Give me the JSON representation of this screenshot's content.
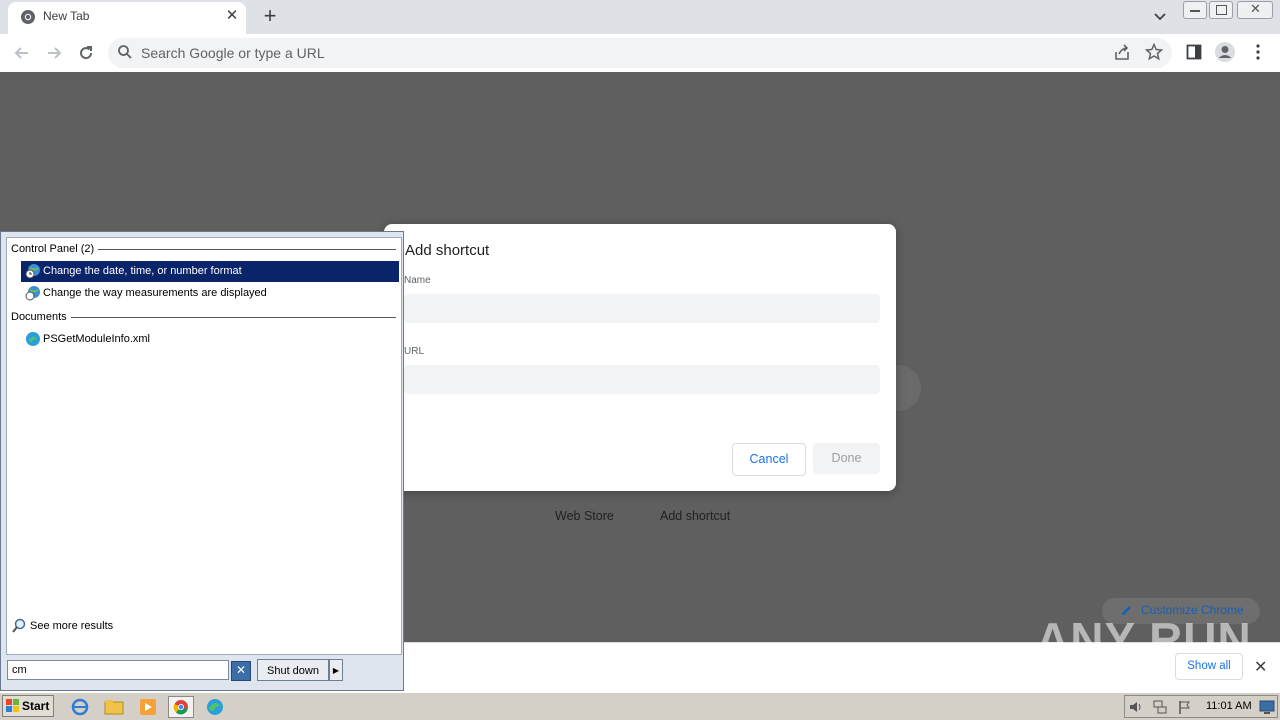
{
  "browser": {
    "tab_title": "New Tab",
    "omnibox_placeholder": "Search Google or type a URL"
  },
  "page": {
    "shortcuts": [
      "Web Store",
      "Add shortcut"
    ],
    "customize_label": "Customize Chrome"
  },
  "dialog": {
    "title": "Add shortcut",
    "name_label": "Name",
    "name_value": "",
    "url_label": "URL",
    "url_value": "",
    "cancel_label": "Cancel",
    "done_label": "Done"
  },
  "download_bar": {
    "show_all_label": "Show all"
  },
  "watermark": "ANY RUN",
  "start_menu": {
    "groups": [
      {
        "title": "Control Panel (2)"
      },
      {
        "title": "Documents"
      }
    ],
    "items": [
      "Change the date, time, or number format",
      "Change the way measurements are displayed",
      "PSGetModuleInfo.xml"
    ],
    "see_more_label": "See more results",
    "search_value": "cm",
    "shutdown_label": "Shut down"
  },
  "taskbar": {
    "start_label": "Start",
    "clock": "11:01 AM"
  },
  "colors": {
    "selection": "#0a246a",
    "chrome_blue": "#1a73e8",
    "overlay": "#5f5f5f"
  }
}
